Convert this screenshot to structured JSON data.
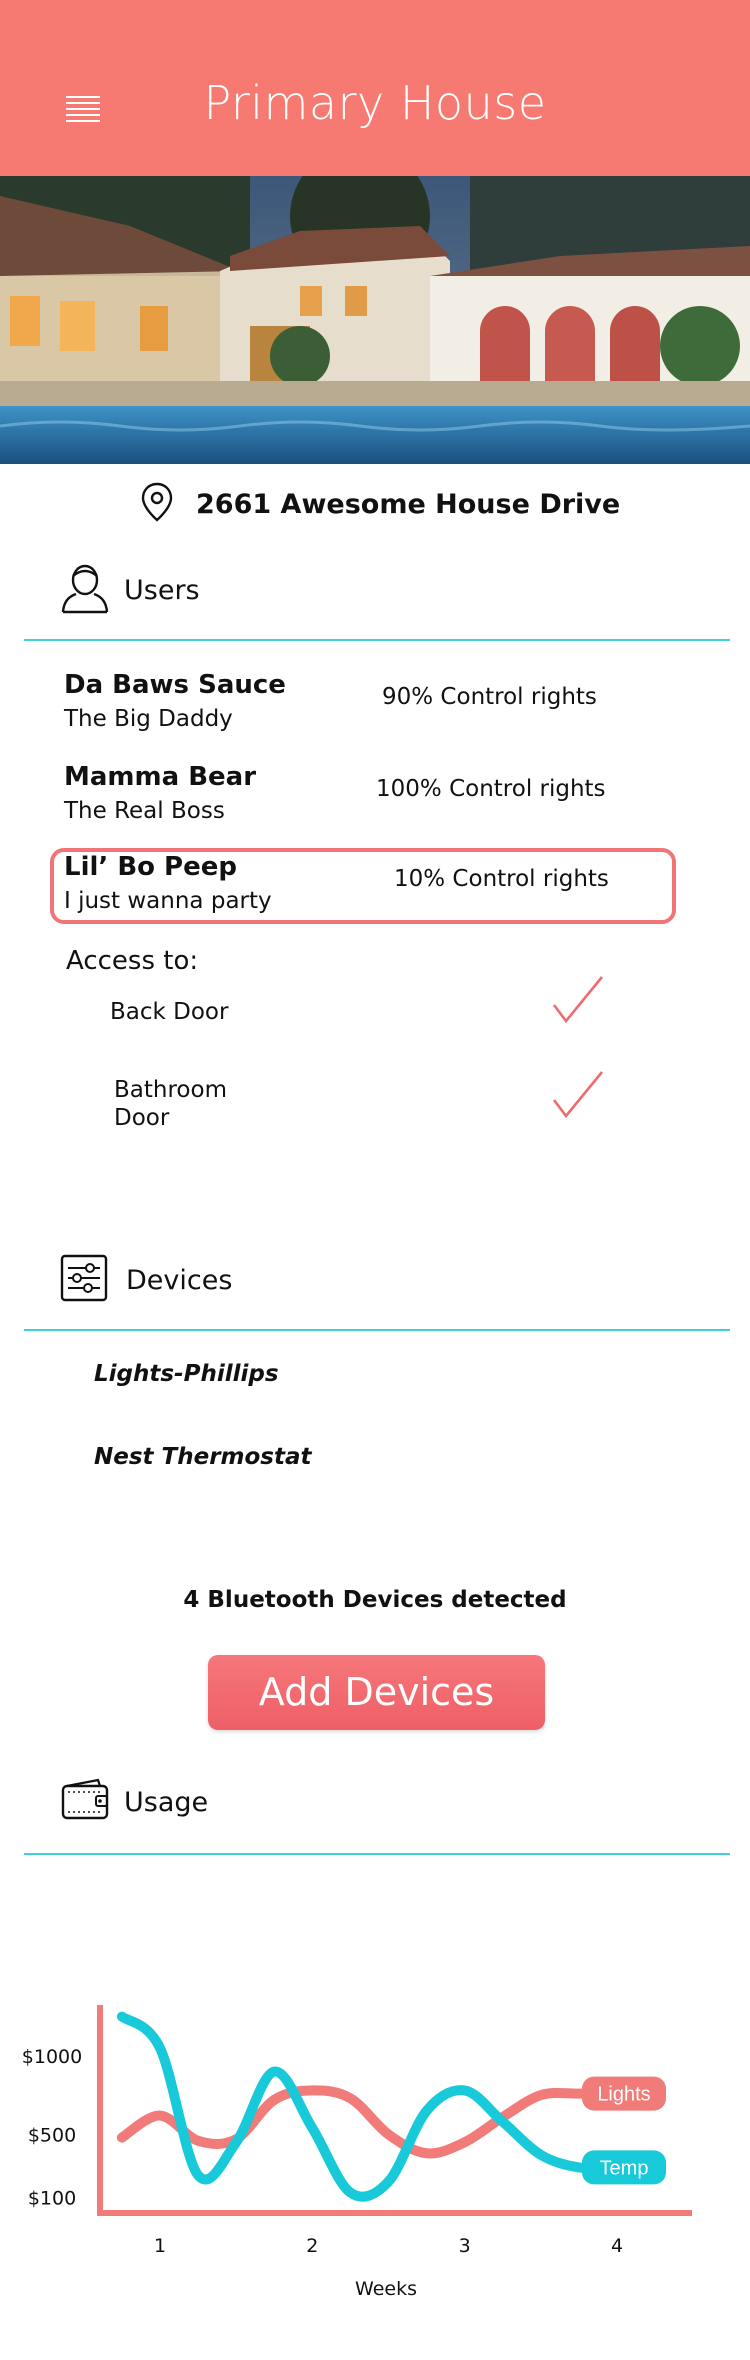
{
  "app": {
    "title": "Primary House"
  },
  "address": "2661 Awesome House Drive",
  "users_section": {
    "title": "Users",
    "users": [
      {
        "name": "Da Baws Sauce",
        "subtitle": "The Big Daddy",
        "rights": "90% Control rights"
      },
      {
        "name": "Mamma Bear",
        "subtitle": "The Real Boss",
        "rights": "100% Control rights"
      },
      {
        "name": "Lil’ Bo Peep",
        "subtitle": "I just wanna party",
        "rights": "10% Control rights",
        "selected": true
      }
    ],
    "access": {
      "title": "Access to:",
      "items": [
        {
          "label": "Back Door",
          "enabled": true
        },
        {
          "label": "Bathroom\nDoor",
          "enabled": true
        }
      ]
    }
  },
  "devices_section": {
    "title": "Devices",
    "devices": [
      "Lights-Phillips",
      "Nest Thermostat"
    ],
    "bluetooth_text": "4  Bluetooth Devices detected",
    "add_button": "Add Devices"
  },
  "usage_section": {
    "title": "Usage"
  },
  "icons": {
    "menu": "menu-icon",
    "location": "location-pin-icon",
    "user": "user-icon",
    "devices": "sliders-icon",
    "usage": "wallet-icon",
    "check": "checkmark-icon"
  },
  "colors": {
    "header": "#f77a72",
    "accent_line": "#3fd1dc",
    "lights": "#f07b78",
    "temp": "#18c9d9",
    "button": "#ee6369"
  },
  "chart_data": {
    "type": "line",
    "x": [
      0.75,
      1.0,
      1.25,
      1.5,
      1.75,
      2.0,
      2.25,
      2.5,
      2.75,
      3.0,
      3.25,
      3.5,
      3.75,
      4.0
    ],
    "xlabel": "Weeks",
    "ylabel": "",
    "xticks": [
      "1",
      "2",
      "3",
      "4"
    ],
    "yticks": [
      "$1000",
      "$500",
      "$100"
    ],
    "ylim": [
      0,
      1400
    ],
    "grid": false,
    "series": [
      {
        "name": "Lights",
        "values": [
          480,
          620,
          460,
          470,
          720,
          780,
          730,
          500,
          380,
          450,
          610,
          750,
          760,
          760
        ]
      },
      {
        "name": "Temp",
        "values": [
          1250,
          1050,
          240,
          450,
          900,
          540,
          130,
          200,
          650,
          780,
          580,
          370,
          290,
          290
        ]
      }
    ]
  }
}
